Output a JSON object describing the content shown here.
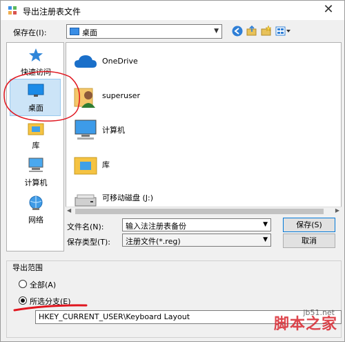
{
  "window": {
    "title": "导出注册表文件",
    "close_glyph": "✕"
  },
  "toolbar": {
    "lookin_label": "保存在(I):",
    "lookin_value": "桌面",
    "arrow": "▼"
  },
  "places": [
    {
      "label": "快速访问",
      "icon": "star-icon"
    },
    {
      "label": "桌面",
      "icon": "desktop-icon",
      "selected": true
    },
    {
      "label": "库",
      "icon": "library-icon"
    },
    {
      "label": "计算机",
      "icon": "computer-icon"
    },
    {
      "label": "网络",
      "icon": "network-icon"
    }
  ],
  "files": [
    {
      "name": "OneDrive",
      "icon": "cloud-icon"
    },
    {
      "name": "superuser",
      "icon": "user-folder-icon"
    },
    {
      "name": "计算机",
      "icon": "computer-icon"
    },
    {
      "name": "库",
      "icon": "library-icon"
    },
    {
      "name": "可移动磁盘 (J:)",
      "icon": "drive-icon"
    }
  ],
  "form": {
    "filename_label": "文件名(N):",
    "filename_value": "输入法注册表备份",
    "filetype_label": "保存类型(T):",
    "filetype_value": "注册文件(*.reg)",
    "save_button": "保存(S)",
    "cancel_button": "取消"
  },
  "export_range": {
    "title": "导出范围",
    "all_label": "全部(A)",
    "selected_label": "所选分支(E)",
    "branch_value": "HKEY_CURRENT_USER\\Keyboard Layout"
  },
  "watermark": {
    "url": "jb51.net",
    "text": "脚本之家"
  },
  "colors": {
    "accent": "#0078d7",
    "annotation": "#e0161f",
    "selection": "#cce4f7"
  }
}
